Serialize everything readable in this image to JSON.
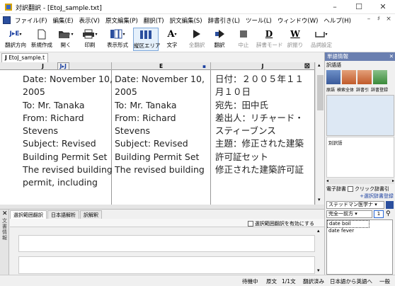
{
  "window": {
    "title": "対訳翻訳 - [EtoJ_sample.txt]",
    "controls": [
      "–",
      "☐",
      "✕"
    ]
  },
  "menubar": {
    "items": [
      "ファイル(F)",
      "編集(E)",
      "表示(V)",
      "原文編集(P)",
      "翻訳(T)",
      "訳文編集(S)",
      "辞書引き(L)",
      "ツール(L)",
      "ウィンドウ(W)",
      "ヘルプ(H)"
    ],
    "mdi_controls": [
      "–",
      "♯",
      "×"
    ]
  },
  "toolbar": {
    "buttons": [
      {
        "label": "翻訳方向",
        "icon": "direction-icon",
        "glyph": "J▸E"
      },
      {
        "label": "新規作成",
        "icon": "new-document-icon"
      },
      {
        "label": "開く",
        "icon": "open-folder-icon"
      },
      {
        "label": "印刷",
        "icon": "printer-icon"
      },
      {
        "label": "表示形式",
        "icon": "layout-icon"
      },
      {
        "label": "縦区エリア",
        "icon": "columns-icon"
      },
      {
        "label": "文字",
        "icon": "font-icon",
        "glyph": "A"
      },
      {
        "label": "全翻訳",
        "icon": "play-all-icon"
      },
      {
        "label": "翻訳",
        "icon": "translate-icon"
      },
      {
        "label": "中止",
        "icon": "stop-icon"
      },
      {
        "label": "辞書モード",
        "icon": "dictionary-mode-icon",
        "glyph": "D"
      },
      {
        "label": "訳振り",
        "icon": "annotate-icon",
        "glyph": "W"
      },
      {
        "label": "品詞設定",
        "icon": "pos-setting-icon"
      }
    ]
  },
  "document": {
    "tab": "EtoJ_sample.t",
    "columns": [
      {
        "header": "J",
        "badge": "J▸J"
      },
      {
        "header": "E",
        "badge": "▪"
      },
      {
        "header": "J",
        "badge": "⊠"
      }
    ],
    "rows": [
      {
        "source": [
          "Date: November 10,",
          "2005",
          "To: Mr. Tanaka",
          "From: Richard",
          "Stevens",
          "Subject: Revised",
          "Building Permit Set",
          "The revised building",
          "permit, including"
        ],
        "english": [
          "Date: November 10,",
          "2005",
          "To: Mr. Tanaka",
          "From: Richard",
          "Stevens",
          "Subject: Revised",
          "Building Permit Set",
          "",
          "The revised building"
        ],
        "japanese": [
          "日付：２００５年１１",
          "月１０日",
          "宛先：田中氏",
          "差出人：リチャード・",
          "スティーブンス",
          "主題：修正された建築",
          "許可証セット",
          "",
          "修正された建築許可証"
        ]
      }
    ]
  },
  "bottom_panel": {
    "side_label": "文書情報",
    "tabs": [
      "選択範囲翻訳",
      "日本語解析",
      "訳解釈"
    ],
    "checkbox_label": "選択範囲翻訳を有効にする",
    "checked": false
  },
  "right_panel": {
    "title": "単語情報",
    "sub_label": "訳語語",
    "tools": [
      "原語",
      "検索全体",
      "辞書引",
      "辞書登録"
    ],
    "list_label": "別訳語",
    "dict_label": "電子辞書",
    "dict_checkbox": "クリック辞書引",
    "dict_link": "+選択辞書登録",
    "dict_select": "ステッドマン医学ナ",
    "match_select": "完全一前方",
    "match_num": "1",
    "results": [
      "date boil",
      "date fever"
    ]
  },
  "statusbar": {
    "items": [
      "待機中",
      "原文",
      "1/1文",
      "翻訳済み",
      "日本語から英語へ",
      "一般"
    ]
  },
  "colors": {
    "accent": "#1a3fa0",
    "panel_header": "#6a7fb0",
    "toolbar_icon": "#2b4f9e"
  }
}
